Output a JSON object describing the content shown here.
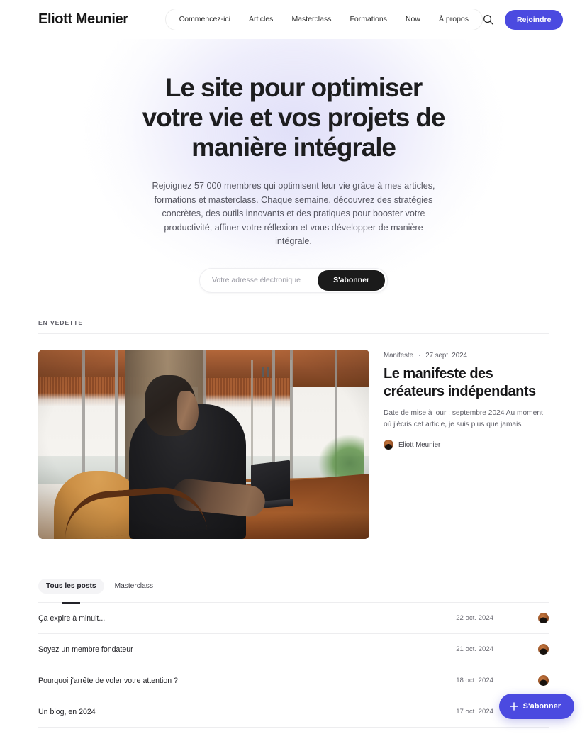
{
  "header": {
    "logo": "Eliott Meunier",
    "nav": [
      {
        "label": "Commencez-ici"
      },
      {
        "label": "Articles"
      },
      {
        "label": "Masterclass"
      },
      {
        "label": "Formations"
      },
      {
        "label": "Now"
      },
      {
        "label": "À propos"
      }
    ],
    "search_icon": "search-icon",
    "join_label": "Rejoindre",
    "accent_color": "#4b4ae0"
  },
  "hero": {
    "title": "Le site pour optimiser votre vie et vos projets de manière intégrale",
    "subtitle": "Rejoignez 57 000 membres qui optimisent leur vie grâce à mes articles, formations et masterclass. Chaque semaine, découvrez des stratégies concrètes, des outils innovants et des pratiques pour booster votre productivité, affiner votre réflexion et vous développer de manière intégrale.",
    "email_placeholder": "Votre adresse électronique",
    "email_value": "",
    "subscribe_label": "S'abonner",
    "subscribe_color": "#1b1b1b"
  },
  "featured": {
    "section_label": "EN VEDETTE",
    "image_alt": "Homme travaillant sur un ordinateur portable devant une fenêtre",
    "category": "Manifeste",
    "separator": "·",
    "date": "27 sept. 2024",
    "title": "Le manifeste des créateurs indépendants",
    "excerpt": "Date de mise à jour : septembre 2024 Au moment où j'écris cet article, je suis plus que jamais",
    "author": "Eliott Meunier"
  },
  "posts_section": {
    "tabs": [
      {
        "label": "Tous les posts",
        "active": true
      },
      {
        "label": "Masterclass",
        "active": false
      }
    ],
    "rows": [
      {
        "title": "Ça expire à minuit...",
        "date": "22 oct. 2024",
        "author": "Eliott Meunier"
      },
      {
        "title": "Soyez un membre fondateur",
        "date": "21 oct. 2024",
        "author": "Eliott Meunier"
      },
      {
        "title": "Pourquoi j'arrête de voler votre attention ?",
        "date": "18 oct. 2024",
        "author": "Eliott Meunier"
      },
      {
        "title": "Un blog, en 2024",
        "date": "17 oct. 2024",
        "author": "Eliott Meunier"
      }
    ]
  },
  "floating": {
    "label": "S'abonner",
    "icon": "plus-icon",
    "color": "#4b4ae0"
  }
}
